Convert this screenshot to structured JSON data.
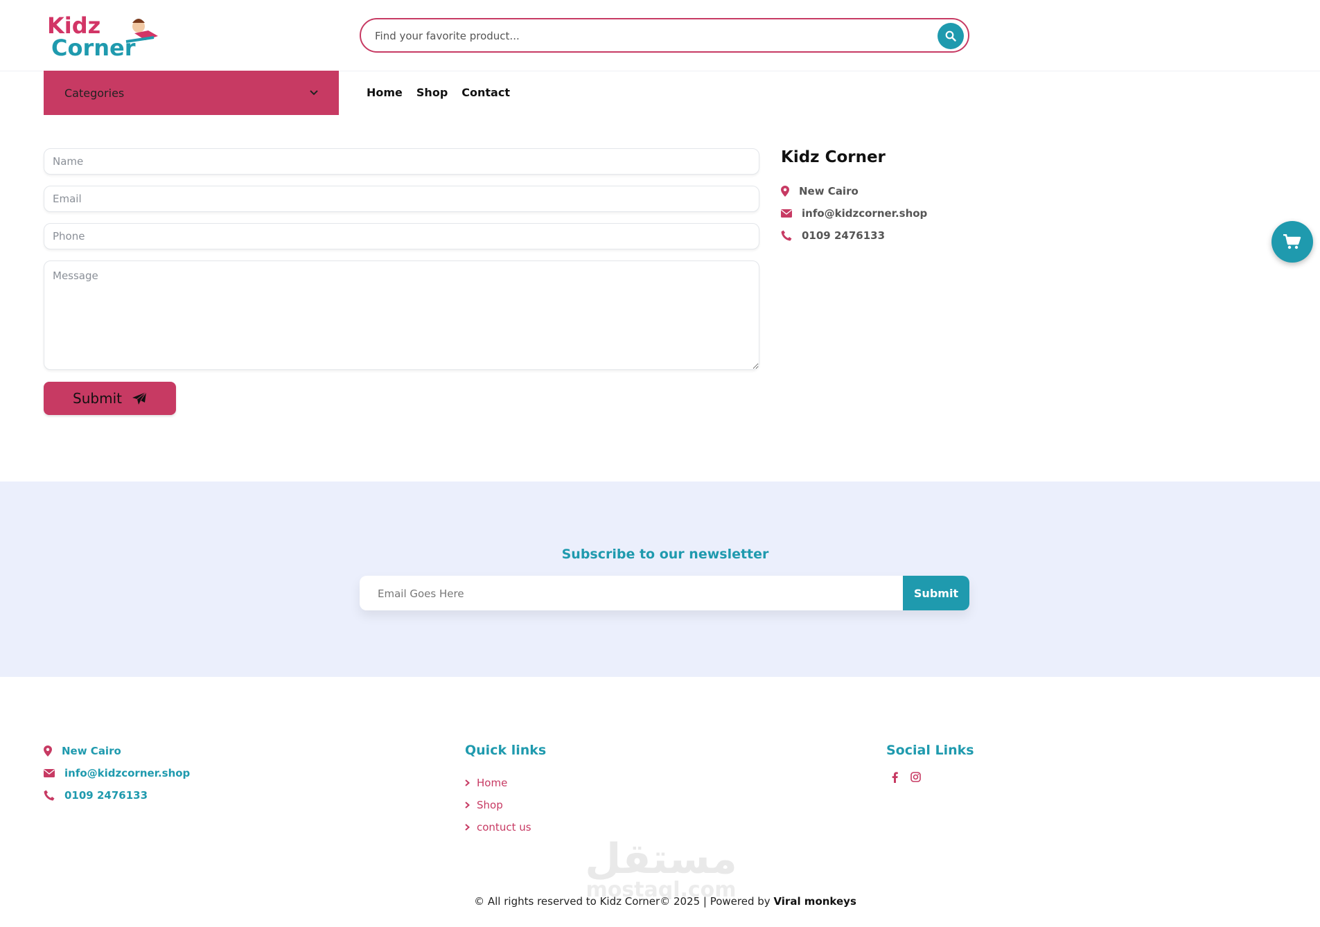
{
  "brand": {
    "logo_line1": "Kidz",
    "logo_line2": "Corner"
  },
  "search": {
    "placeholder": "Find your favorite product..."
  },
  "nav": {
    "categories_label": "Categories",
    "links": [
      "Home",
      "Shop",
      "Contact"
    ]
  },
  "contact_form": {
    "name_placeholder": "Name",
    "email_placeholder": "Email",
    "phone_placeholder": "Phone",
    "message_placeholder": "Message",
    "submit_label": "Submit"
  },
  "contact_card": {
    "title": "Kidz Corner",
    "location": "New Cairo",
    "email": "info@kidzcorner.shop",
    "phone": "0109 2476133"
  },
  "newsletter": {
    "title": "Subscribe to our newsletter",
    "placeholder": "Email Goes Here",
    "submit_label": "Submit"
  },
  "footer": {
    "location": "New Cairo",
    "email": "info@kidzcorner.shop",
    "phone": "0109 2476133",
    "quick_links_title": "Quick links",
    "quick_links": [
      "Home",
      "Shop",
      "contuct us"
    ],
    "social_title": "Social Links",
    "social_icons": [
      "facebook-icon",
      "instagram-icon"
    ],
    "copyright_text": "© All rights reserved to Kidz Corner© 2025 | Powered by ",
    "powered_by": "Viral monkeys",
    "watermark_arabic": "مستقل",
    "watermark_latin": "mostaql.com"
  },
  "colors": {
    "primary_pink": "#c73a63",
    "teal": "#1f9aae",
    "newsletter_bg": "#ebeffc"
  }
}
